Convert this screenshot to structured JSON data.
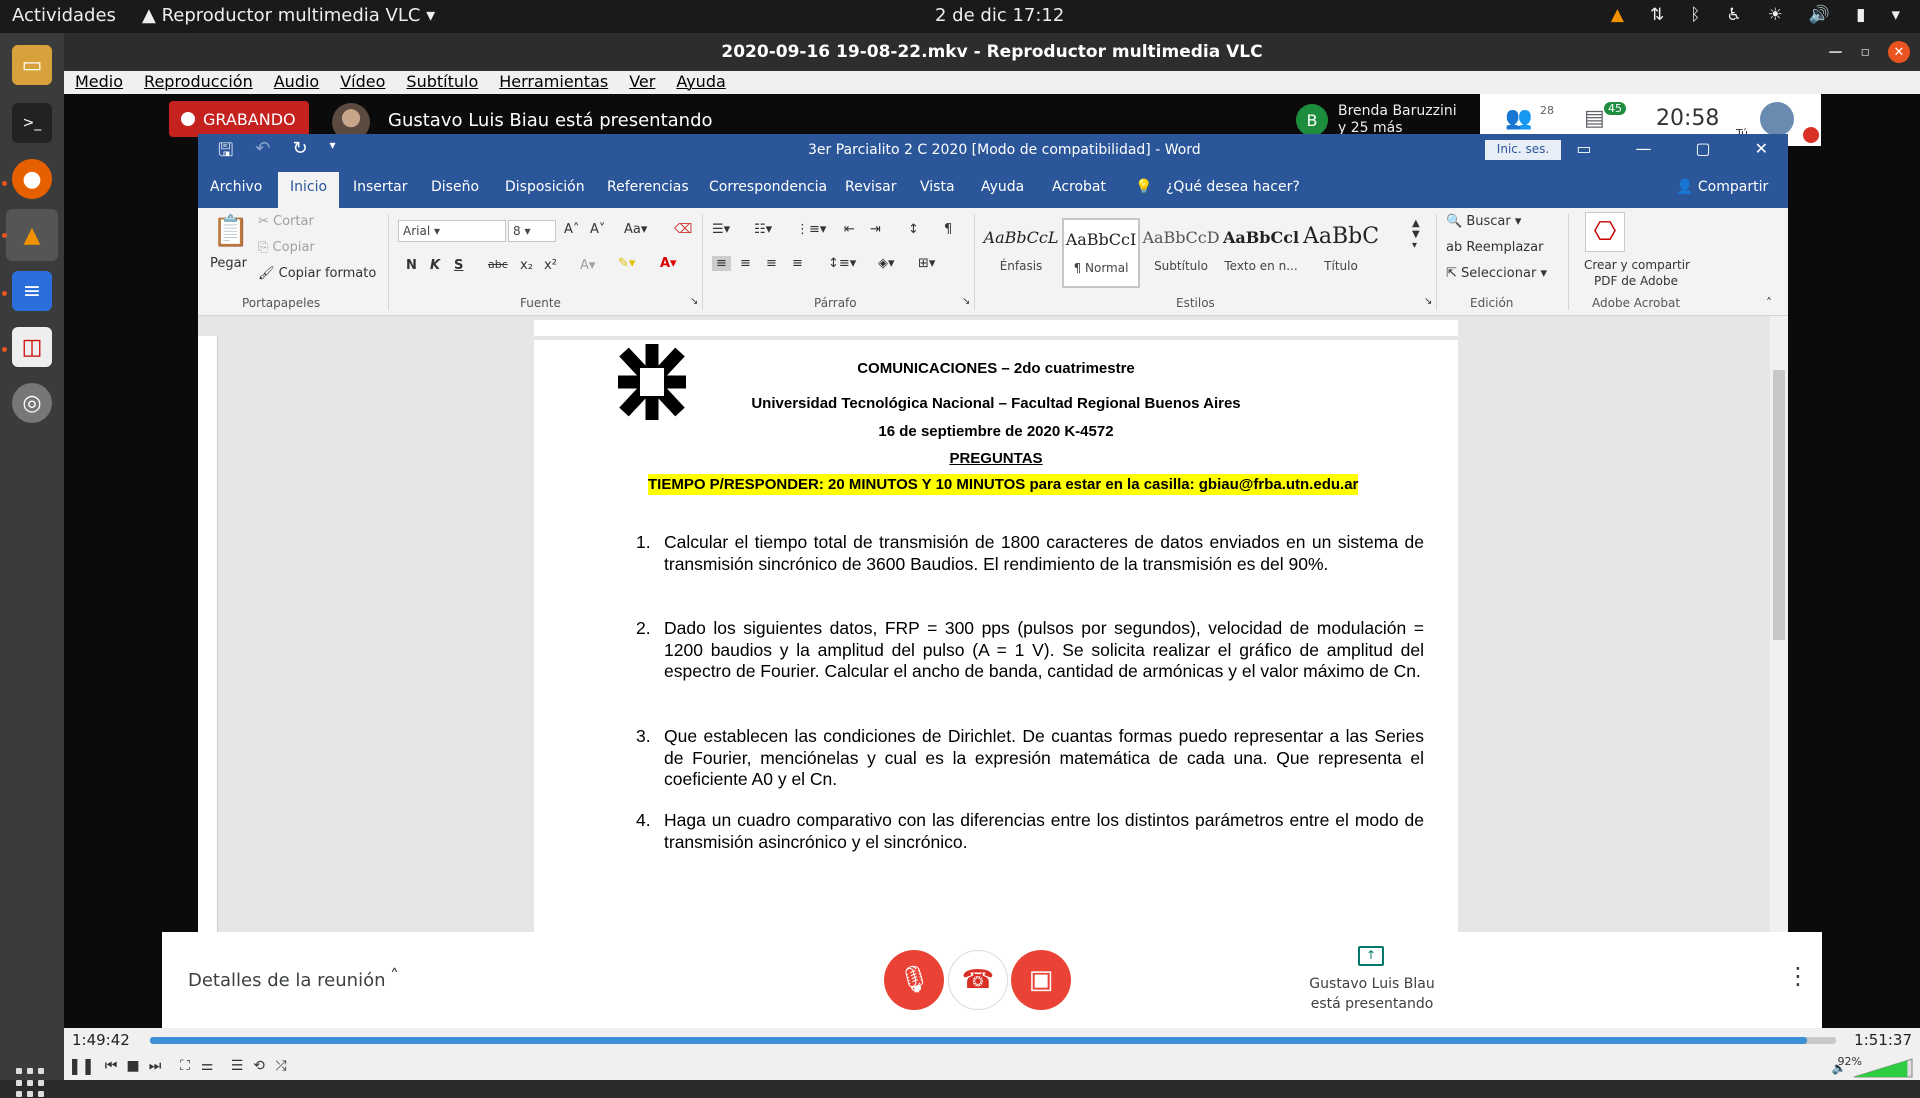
{
  "topbar": {
    "activities": "Actividades",
    "app_menu": "Reproductor multimedia VLC",
    "clock": "2 de dic  17:12"
  },
  "vlc": {
    "window_title": "2020-09-16 19-08-22.mkv - Reproductor multimedia VLC",
    "menu": [
      "Medio",
      "Reproducción",
      "Audio",
      "Vídeo",
      "Subtítulo",
      "Herramientas",
      "Ver",
      "Ayuda"
    ],
    "time_elapsed": "1:49:42",
    "time_total": "1:51:37",
    "progress": 0.983,
    "volume": "92%",
    "volume_level": 0.92
  },
  "meet": {
    "recording_label": "GRABANDO",
    "presenting_text": "Gustavo Luis Biau está presentando",
    "participant_avatar_letter": "B",
    "participant_line1": "Brenda Baruzzini",
    "participant_line2": "y 25 más",
    "people_count": "28",
    "chat_count": "45",
    "time": "20:58",
    "you_label": "Tú",
    "details_label": "Detalles de la reunión",
    "presenter_line1": "Gustavo Luis Blau",
    "presenter_line2": "está presentando"
  },
  "word": {
    "title": "3er Parcialito   2 C 2020 [Modo de compatibilidad]  -  Word",
    "signin": "Inic. ses.",
    "tabs": [
      "Archivo",
      "Inicio",
      "Insertar",
      "Diseño",
      "Disposición",
      "Referencias",
      "Correspondencia",
      "Revisar",
      "Vista",
      "Ayuda",
      "Acrobat"
    ],
    "tell_me": "¿Qué desea hacer?",
    "share": "Compartir",
    "clipboard": {
      "paste": "Pegar",
      "cut": "Cortar",
      "copy": "Copiar",
      "format": "Copiar formato",
      "group": "Portapapeles"
    },
    "font": {
      "name": "Arial",
      "size": "8",
      "group": "Fuente",
      "bold": "N",
      "italic": "K",
      "underline": "S"
    },
    "paragraph_group": "Párrafo",
    "styles": [
      {
        "sample": "AaBbCcL",
        "name": "Énfasis"
      },
      {
        "sample": "AaBbCcI",
        "name": "¶ Normal"
      },
      {
        "sample": "AaBbCcD",
        "name": "Subtítulo"
      },
      {
        "sample": "AaBbCcl",
        "name": "Texto en n..."
      },
      {
        "sample": "AaBbC",
        "name": "Título"
      }
    ],
    "styles_group": "Estilos",
    "editing": {
      "find": "Buscar",
      "replace": "Reemplazar",
      "select": "Seleccionar",
      "group": "Edición"
    },
    "acrobat": {
      "line1": "Crear y compartir",
      "line2": "PDF de Adobe",
      "group": "Adobe Acrobat"
    }
  },
  "document": {
    "line1": "COMUNICACIONES – 2do cuatrimestre",
    "line2": "Universidad Tecnológica Nacional – Facultad Regional Buenos Aires",
    "line3": "16 de septiembre de 2020  K-4572",
    "line4": "PREGUNTAS",
    "highlight": "TIEMPO P/RESPONDER: 20 MINUTOS Y 10 MINUTOS para estar en la casilla: gbiau@frba.utn.edu.ar",
    "questions": [
      {
        "num": "1.",
        "text": "Calcular el tiempo total de transmisión de 1800 caracteres de datos enviados en un sistema de transmisión sincrónico de 3600 Baudios. El rendimiento de la transmisión es del 90%."
      },
      {
        "num": "2.",
        "text": "Dado los siguientes datos, FRP = 300 pps (pulsos por segundos), velocidad de modulación = 1200 baudios y la amplitud del pulso (A = 1 V). Se solicita realizar el gráfico de amplitud del espectro de Fourier. Calcular el ancho de banda, cantidad de armónicas y el valor máximo de Cn."
      },
      {
        "num": "3.",
        "text": "Que establecen las condiciones de Dirichlet. De cuantas formas puedo representar a las Series de Fourier, menciónelas y cual es la expresión matemática de cada una. Que representa el coeficiente A0 y el Cn."
      },
      {
        "num": "4.",
        "text": "Haga un cuadro comparativo con las diferencias entre los distintos parámetros entre el modo de transmisión asincrónico y el sincrónico."
      }
    ]
  }
}
